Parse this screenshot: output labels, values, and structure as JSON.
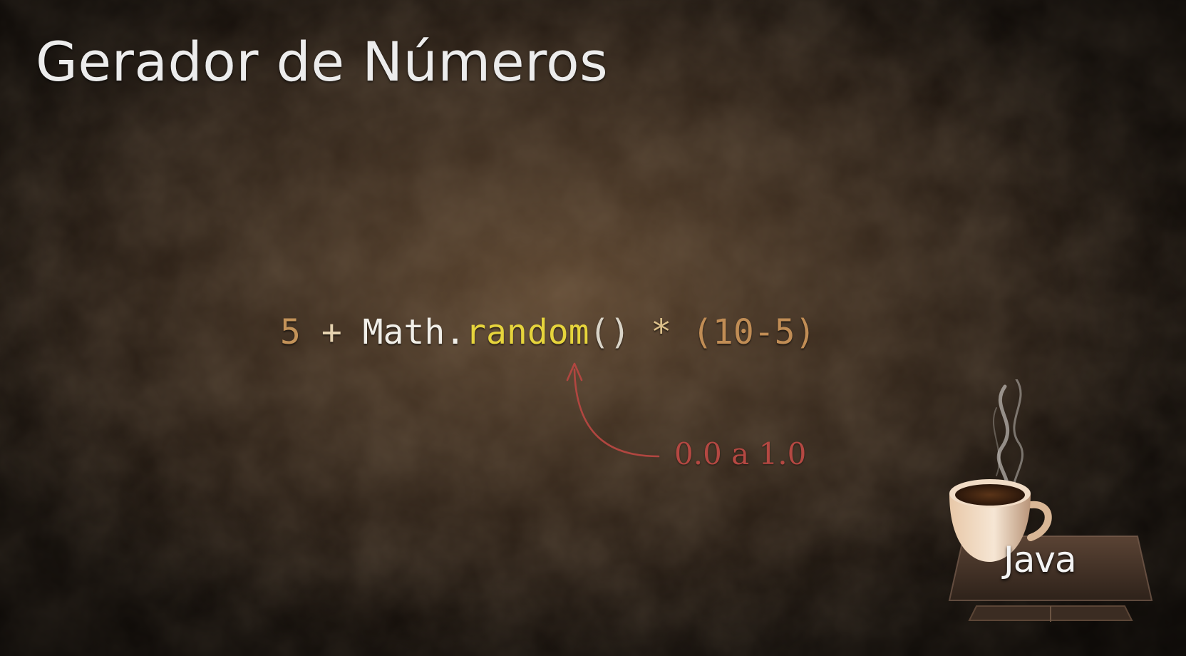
{
  "slide": {
    "title": "Gerador de Números",
    "code": {
      "base": "5",
      "plus": "+",
      "class_name": "Math",
      "dot": ".",
      "method": "random",
      "parens": "()",
      "multiply": "*",
      "range_expr": "(10-5)"
    },
    "annotation": "0.0 a 1.0",
    "logo_text": "Java"
  },
  "colors": {
    "background": "#3c2b1d",
    "title": "#ececec",
    "number": "#c49359",
    "method": "#e6d43c",
    "annotation": "#b54842"
  },
  "icons": {
    "arrow": "curved-arrow-icon",
    "logo": "coffee-cup-icon"
  }
}
